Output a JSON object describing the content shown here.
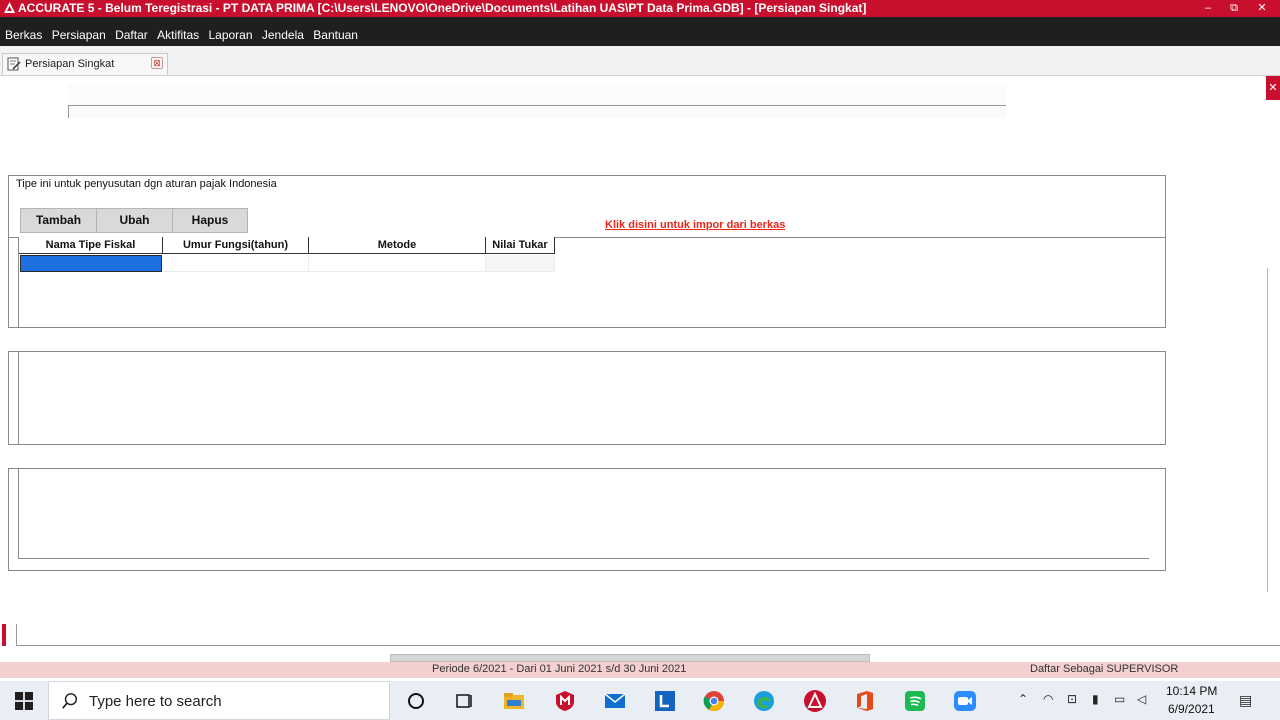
{
  "window": {
    "title": "ACCURATE 5 - Belum Teregistrasi - PT DATA PRIMA   [C:\\Users\\LENOVO\\OneDrive\\Documents\\Latihan UAS\\PT Data Prima.GDB] - [Persiapan Singkat]",
    "minimize": "–",
    "restore": "⧉",
    "close": "✕"
  },
  "menu": [
    "Berkas",
    "Persiapan",
    "Daftar",
    "Aktifitas",
    "Laporan",
    "Jendela",
    "Bantuan"
  ],
  "tab": {
    "label": "Persiapan Singkat",
    "close": "⊠"
  },
  "form": {
    "close_glyph": "✕",
    "description": "Tipe ini untuk penyusutan dgn aturan pajak Indonesia",
    "buttons": {
      "add": "Tambah",
      "edit": "Ubah",
      "delete": "Hapus"
    },
    "import_link": "Klik disini untuk impor dari berkas",
    "grid": {
      "columns": [
        "Nama Tipe Fiskal",
        "Umur Fungsi(tahun)",
        "Metode",
        "Nilai Tukar"
      ],
      "rows": [
        [
          "",
          "",
          "",
          ""
        ]
      ]
    }
  },
  "status": {
    "periode": "Periode 6/2021 - Dari 01 Juni 2021 s/d 30 Juni 2021",
    "user": "Daftar Sebagai SUPERVISOR"
  },
  "taskbar": {
    "search_placeholder": "Type here to search",
    "time": "10:14 PM",
    "date": "6/9/2021",
    "icons": [
      "windows-start-icon",
      "search-icon",
      "cortana-icon",
      "task-view-icon",
      "file-explorer-icon",
      "mcafee-icon",
      "mail-icon",
      "app-l-icon",
      "chrome-icon",
      "edge-icon",
      "accurate-icon",
      "office-icon",
      "spotify-icon",
      "zoom-icon"
    ]
  },
  "colors": {
    "titlebar": "#c8102e",
    "menubar": "#1f1f1f",
    "selection": "#1e6fe0",
    "link": "#e8261a",
    "statusbar": "#f4cfcf"
  }
}
